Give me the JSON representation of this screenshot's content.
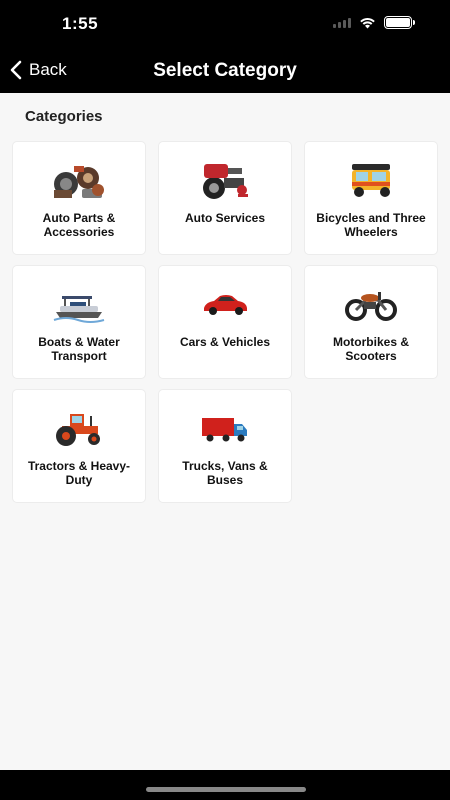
{
  "status_bar": {
    "time": "1:55"
  },
  "header": {
    "back_label": "Back",
    "title": "Select Category"
  },
  "section_title": "Categories",
  "categories": [
    {
      "label": "Auto Parts & Accessories",
      "icon": "auto-parts-icon"
    },
    {
      "label": "Auto Services",
      "icon": "auto-services-icon"
    },
    {
      "label": "Bicycles and Three Wheelers",
      "icon": "tuk-tuk-icon"
    },
    {
      "label": "Boats & Water Transport",
      "icon": "boat-icon"
    },
    {
      "label": "Cars & Vehicles",
      "icon": "car-icon"
    },
    {
      "label": "Motorbikes & Scooters",
      "icon": "motorbike-icon"
    },
    {
      "label": "Tractors & Heavy-Duty",
      "icon": "tractor-icon"
    },
    {
      "label": "Trucks, Vans & Buses",
      "icon": "truck-icon"
    }
  ]
}
